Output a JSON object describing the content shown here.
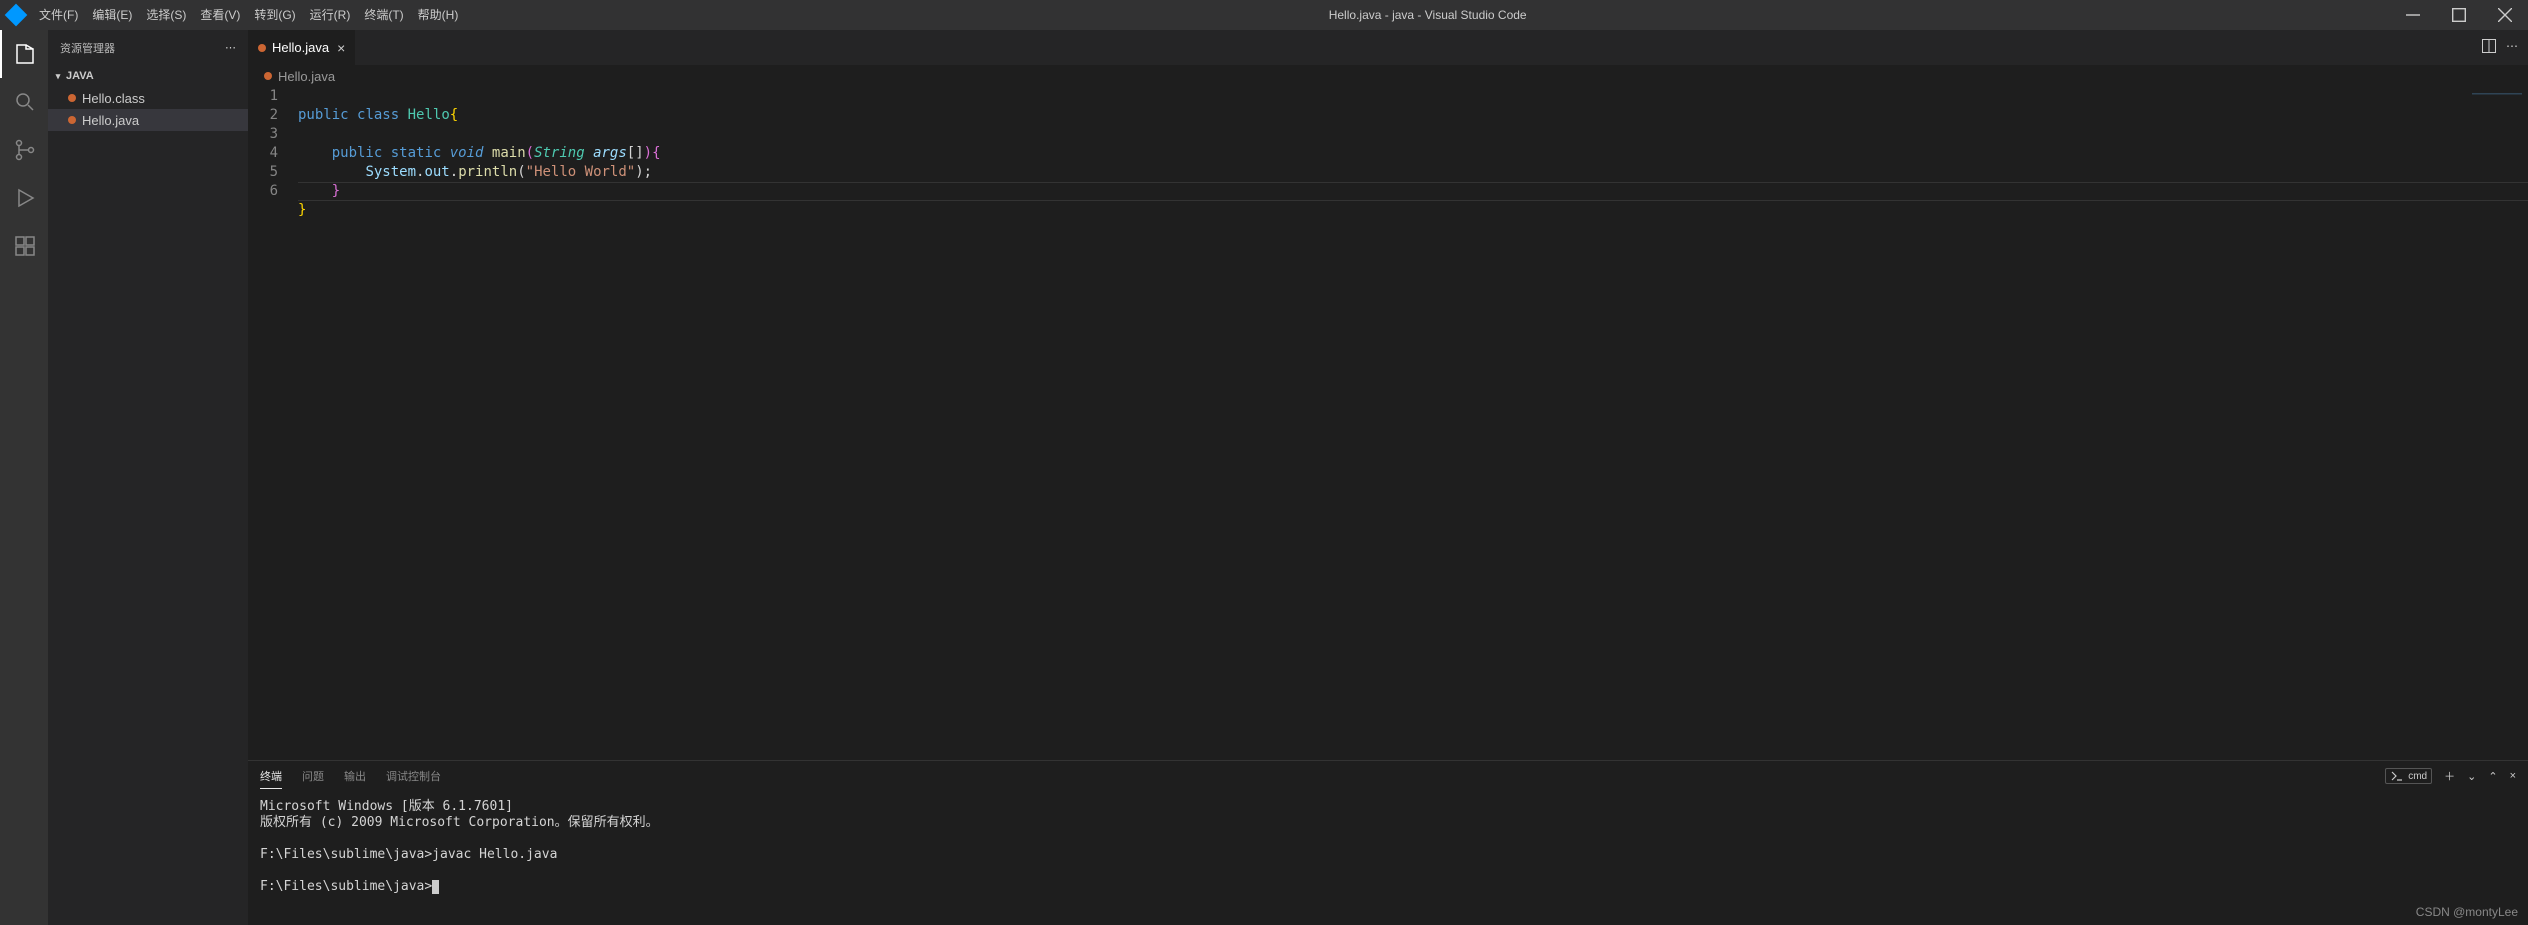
{
  "title": "Hello.java - java - Visual Studio Code",
  "menu": [
    "文件(F)",
    "编辑(E)",
    "选择(S)",
    "查看(V)",
    "转到(G)",
    "运行(R)",
    "终端(T)",
    "帮助(H)"
  ],
  "sidebar": {
    "title": "资源管理器",
    "section": "JAVA",
    "files": [
      "Hello.class",
      "Hello.java"
    ],
    "active": 1
  },
  "tab": {
    "name": "Hello.java"
  },
  "breadcrumb": "Hello.java",
  "code": {
    "lines": [
      1,
      2,
      3,
      4,
      5,
      6
    ],
    "kw_public": "public",
    "kw_class": "class",
    "kw_static": "static",
    "kw_void": "void",
    "cls": "Hello",
    "fn_main": "main",
    "typ_string": "String",
    "param_args": "args",
    "obj_system": "System",
    "obj_out": "out",
    "fn_println": "println",
    "str": "\"Hello World\""
  },
  "panel": {
    "tabs": [
      "终端",
      "问题",
      "输出",
      "调试控制台"
    ],
    "active": 0,
    "shell": "cmd",
    "lines": [
      "Microsoft Windows [版本 6.1.7601]",
      "版权所有 (c) 2009 Microsoft Corporation。保留所有权利。",
      "",
      "F:\\Files\\sublime\\java>javac Hello.java",
      "",
      "F:\\Files\\sublime\\java>"
    ]
  },
  "watermark": "CSDN @montyLee"
}
